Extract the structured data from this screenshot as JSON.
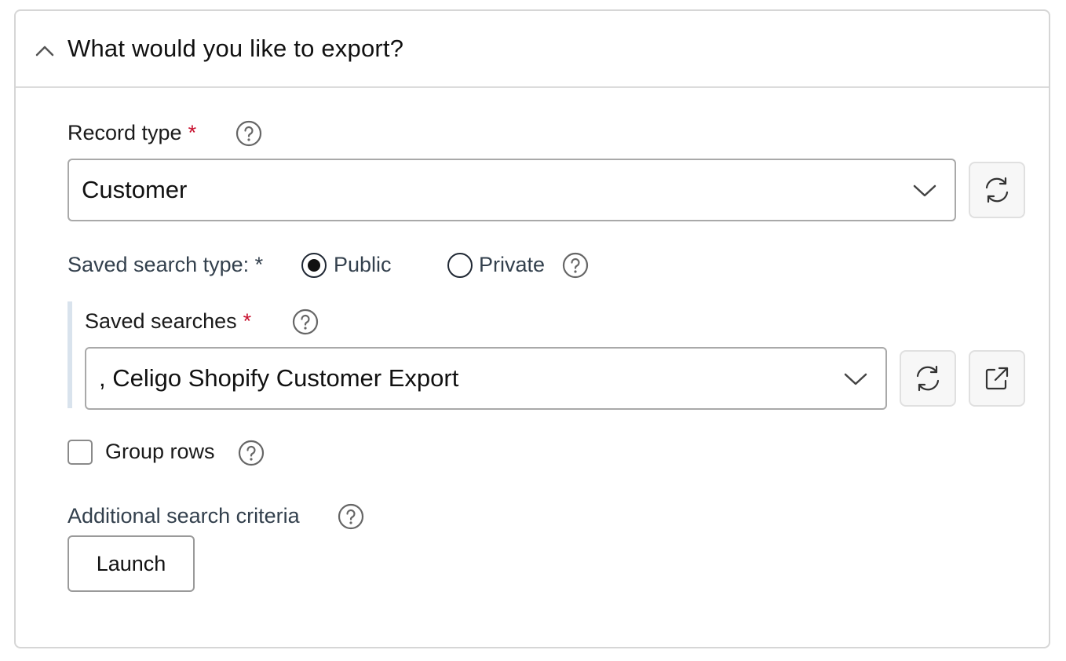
{
  "section": {
    "title": "What would you like to export?"
  },
  "record_type": {
    "label": "Record type",
    "required_mark": "*",
    "value": "Customer"
  },
  "saved_search_type": {
    "label": "Saved search type: *",
    "options": [
      {
        "label": "Public",
        "selected": true
      },
      {
        "label": "Private",
        "selected": false
      }
    ]
  },
  "saved_searches": {
    "label": "Saved searches",
    "required_mark": "*",
    "value": ", Celigo Shopify Customer Export"
  },
  "group_rows": {
    "label": "Group rows",
    "checked": false
  },
  "additional_criteria": {
    "label": "Additional search criteria",
    "button_label": "Launch"
  },
  "colors": {
    "required": "#c8102e",
    "border": "#a9a9a9",
    "accent_bar": "#d9e3ed"
  },
  "icons": [
    "chevron-up-icon",
    "help-icon",
    "chevron-down-icon",
    "refresh-icon",
    "open-external-icon"
  ]
}
